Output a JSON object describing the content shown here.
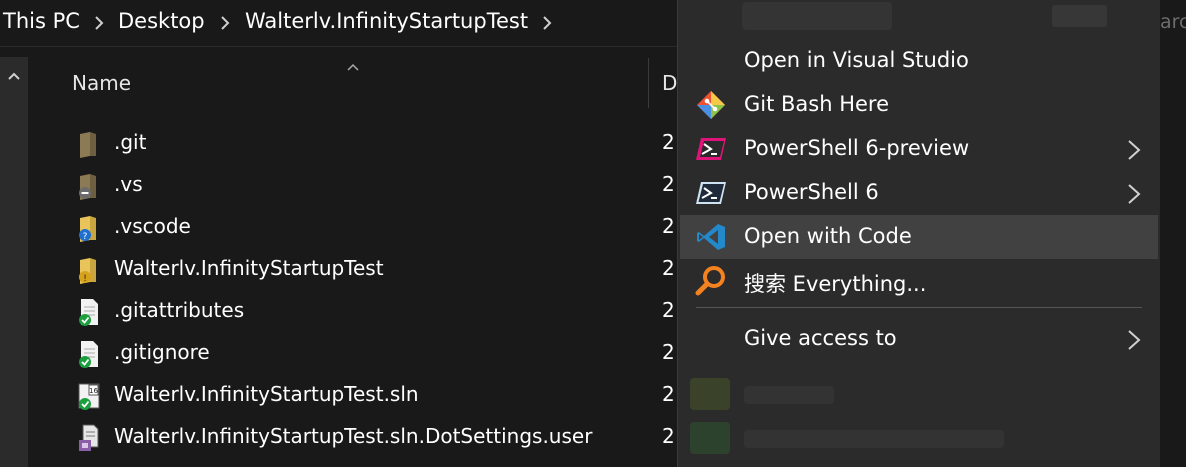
{
  "breadcrumb": {
    "items": [
      "This PC",
      "Desktop",
      "Walterlv.InfinityStartupTest"
    ],
    "search_hint": "arc"
  },
  "file_list": {
    "columns": {
      "name": "Name",
      "date": "D"
    },
    "rows": [
      {
        "name": ".git",
        "date": "2",
        "icon": "folder-icon"
      },
      {
        "name": ".vs",
        "date": "2",
        "icon": "folder-ignored-icon"
      },
      {
        "name": ".vscode",
        "date": "2",
        "icon": "folder-unknown-icon"
      },
      {
        "name": "Walterlv.InfinityStartupTest",
        "date": "2",
        "icon": "folder-modified-icon"
      },
      {
        "name": ".gitattributes",
        "date": "2",
        "icon": "file-synced-icon"
      },
      {
        "name": ".gitignore",
        "date": "2",
        "icon": "file-synced-icon"
      },
      {
        "name": "Walterlv.InfinityStartupTest.sln",
        "date": "2",
        "icon": "vs-solution-icon"
      },
      {
        "name": "Walterlv.InfinityStartupTest.sln.DotSettings.user",
        "date": "2",
        "icon": "settings-file-icon"
      }
    ]
  },
  "context_menu": {
    "items": [
      {
        "label": "Open in Visual Studio",
        "icon": "visual-studio-icon"
      },
      {
        "label": "Git Bash Here",
        "icon": "git-icon"
      },
      {
        "label": "PowerShell 6-preview",
        "icon": "powershell-preview-icon",
        "submenu": true
      },
      {
        "label": "PowerShell 6",
        "icon": "powershell-icon",
        "submenu": true
      },
      {
        "label": "Open with Code",
        "icon": "vscode-icon",
        "highlighted": true
      },
      {
        "label": "搜索 Everything...",
        "icon": "everything-search-icon"
      },
      {
        "label": "Give access to",
        "icon": "",
        "submenu": true
      }
    ]
  },
  "colors": {
    "background": "#191919",
    "menu_background": "#2b2b2b",
    "menu_highlight": "#414141",
    "text": "#ffffff"
  }
}
